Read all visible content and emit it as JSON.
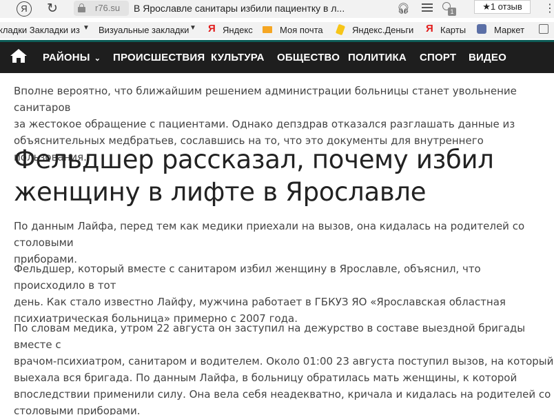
{
  "browser": {
    "yandex_button": "Я",
    "domain": "r76.su",
    "title": "В Ярославле санитары избили пациентку в л...",
    "reviews": "★1 отзыв",
    "extension_badge": "1"
  },
  "bookmarks": {
    "items": [
      "кладки Закладки из",
      "Визуальные закладки",
      "Яндекс",
      "Моя почта",
      "Яндекс.Деньги",
      "Карты",
      "Маркет"
    ],
    "yandex_letter": "Я"
  },
  "nav": {
    "items": [
      "РАЙОНЫ",
      "ПРОИСШЕСТВИЯ",
      "КУЛЬТУРА",
      "ОБЩЕСТВО",
      "ПОЛИТИКА",
      "СПОРТ",
      "ВИДЕО"
    ],
    "dropdown_glyph": "⌄",
    "active_border_color": "#0e5c57",
    "background_color": "#1e1e1e"
  },
  "article": {
    "intro_lines": [
      "Вполне вероятно, что ближайшим решением администрации больницы станет увольнение санитаров",
      "за жестокое обращение с пациентами. Однако депздрав отказался разглашать данные из",
      "объяснительных медбратьев, сославшись на то, что это документы для внутреннего пользования."
    ],
    "heading_lines": [
      "Фельдшер рассказал, почему избил",
      "женщину в лифте в Ярославле"
    ],
    "p1_lines": [
      "По данным Лайфа, перед тем как медики приехали на вызов, она кидалась на родителей со столовыми",
      "приборами."
    ],
    "p2_lines": [
      "Фельдшер, который вместе с санитаром избил женщину в Ярославле, объяснил, что происходило в тот",
      "день. Как стало известно Лайфу, мужчина работает в ГБКУЗ ЯО «Ярославская областная",
      "психиатрическая больница» примерно с 2007 года."
    ],
    "p3_lines": [
      "По словам медика, утром 22 августа он заступил на дежурство в составе выездной бригады вместе с",
      "врачом-психиатром, санитаром и водителем. Около 01:00 23 августа поступил вызов, на который",
      "выехала вся бригада. По данным Лайфа, в больницу обратилась мать женщины, к которой",
      "впоследствии применили силу. Она вела себя неадекватно, кричала и кидалась на родителей со",
      "столовыми приборами."
    ]
  }
}
